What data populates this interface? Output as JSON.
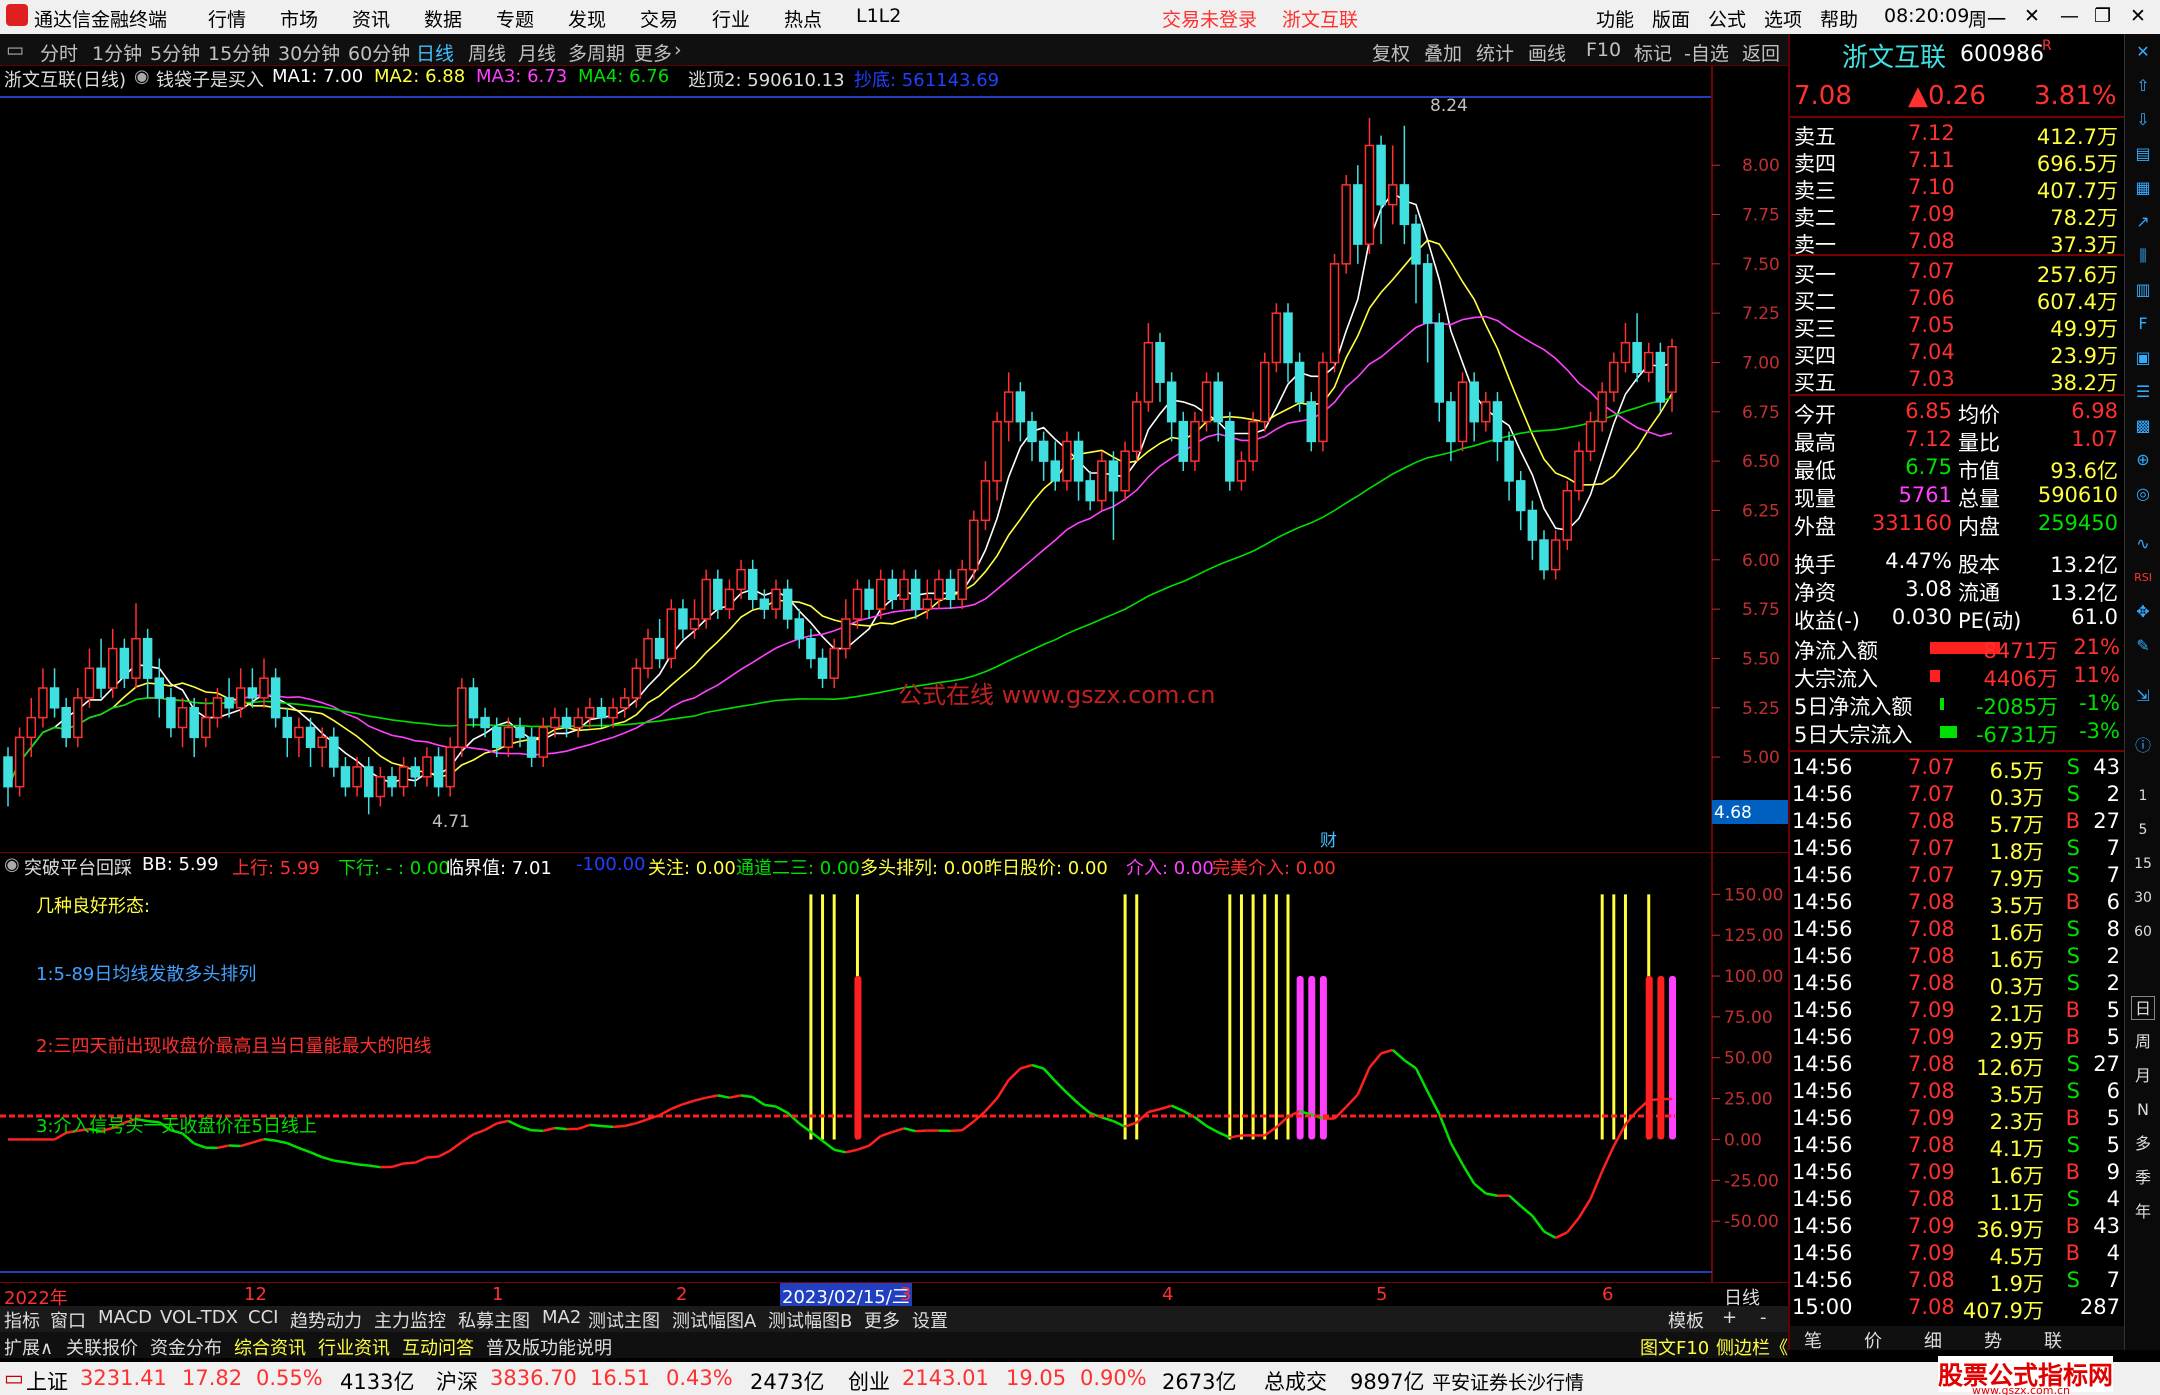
{
  "app": {
    "title": "通达信金融终端",
    "menu": [
      "行情",
      "市场",
      "资讯",
      "数据",
      "专题",
      "发现",
      "交易",
      "行业",
      "热点",
      "L1L2"
    ],
    "login": "交易未登录",
    "stock_title": "浙文互联",
    "right_menu": [
      "功能",
      "版面",
      "公式",
      "选项",
      "帮助"
    ],
    "time": "08:20:09",
    "weekday": "周一"
  },
  "periods": [
    "分时",
    "1分钟",
    "5分钟",
    "15分钟",
    "30分钟",
    "60分钟",
    "日线",
    "周线",
    "月线",
    "多周期",
    "更多"
  ],
  "chart_tools": [
    "复权",
    "叠加",
    "统计",
    "画线",
    "F10",
    "标记",
    "-自选",
    "返回"
  ],
  "main_legend": {
    "name": "浙文互联(日线)",
    "formula": "钱袋子是买入",
    "ma1": "MA1: 7.00",
    "ma2": "MA2: 6.88",
    "ma3": "MA3: 6.73",
    "ma4": "MA4: 6.76",
    "top": "逃顶2: 590610.13",
    "bottom": "抄底: 561143.69"
  },
  "watermark": "公式在线  www.gszx.com.cn",
  "high_label": "8.24",
  "low_label": "4.71",
  "price_axis": [
    "8.00",
    "7.75",
    "7.50",
    "7.25",
    "7.00",
    "6.75",
    "6.50",
    "6.25",
    "6.00",
    "5.75",
    "5.50",
    "5.25",
    "5.00"
  ],
  "cursor_price": "4.68",
  "cai": "财",
  "sub_legend": {
    "name": "突破平台回踩",
    "bb": "BB: 5.99",
    "up": "上行: 5.99",
    "down": "下行: - : 0.00",
    "crit": "临界值: 7.01",
    "m100": "-100.00",
    "focus": "关注: 0.00",
    "channel": "通道二三: 0.00",
    "bull": "多头排列: 0.00",
    "yday": "昨日股价: 0.00",
    "enter": "介入: 0.00",
    "perfect": "完美介入: 0.00"
  },
  "sub_notes": [
    "几种良好形态:",
    "1:5-89日均线发散多头排列",
    "2:三四天前出现收盘价最高且当日量能最大的阳线",
    "3:介入信号头一天收盘价在5日线上"
  ],
  "sub_axis": [
    "150.00",
    "125.00",
    "100.00",
    "75.00",
    "50.00",
    "25.00",
    "0.00",
    "-25.00",
    "-50.00"
  ],
  "date_axis": {
    "labels": [
      "2022年",
      "12",
      "1",
      "2",
      "2023/02/15/三",
      "3",
      "4",
      "5",
      "6"
    ],
    "cycle": "日线"
  },
  "bottom_tabs": [
    "指标",
    "窗口",
    "MACD",
    "VOL-TDX",
    "CCI",
    "趋势动力",
    "主力监控",
    "私募主图",
    "MA2",
    "测试主图",
    "测试幅图A",
    "测试幅图B",
    "更多",
    "设置"
  ],
  "bottom_right": [
    "模板",
    "+",
    "-"
  ],
  "toolbar2": [
    "扩展∧",
    "关联报价",
    "资金分布",
    "综合资讯",
    "行业资讯",
    "互动问答",
    "普及版功能说明"
  ],
  "quote": {
    "name": "浙文互联",
    "code": "600986",
    "price": "7.08",
    "change": "▲0.26",
    "pct": "3.81%",
    "asks": [
      [
        "卖五",
        "7.12",
        "412.7万"
      ],
      [
        "卖四",
        "7.11",
        "696.5万"
      ],
      [
        "卖三",
        "7.10",
        "407.7万"
      ],
      [
        "卖二",
        "7.09",
        "78.2万"
      ],
      [
        "卖一",
        "7.08",
        "37.3万"
      ]
    ],
    "bids": [
      [
        "买一",
        "7.07",
        "257.6万"
      ],
      [
        "买二",
        "7.06",
        "607.4万"
      ],
      [
        "买三",
        "7.05",
        "49.9万"
      ],
      [
        "买四",
        "7.04",
        "23.9万"
      ],
      [
        "买五",
        "7.03",
        "38.2万"
      ]
    ],
    "stats": [
      [
        "今开",
        "6.85",
        "均价",
        "6.98"
      ],
      [
        "最高",
        "7.12",
        "量比",
        "1.07"
      ],
      [
        "最低",
        "6.75",
        "市值",
        "93.6亿"
      ],
      [
        "现量",
        "5761",
        "总量",
        "590610"
      ],
      [
        "外盘",
        "331160",
        "内盘",
        "259450"
      ],
      [
        "换手",
        "4.47%",
        "股本",
        "13.2亿"
      ],
      [
        "净资",
        "3.08",
        "流通",
        "13.2亿"
      ],
      [
        "收益(-)",
        "0.030",
        "PE(动)",
        "61.0"
      ]
    ],
    "flows": [
      [
        "净流入额",
        "8471万",
        "21%"
      ],
      [
        "大宗流入",
        "4406万",
        "11%"
      ],
      [
        "5日净流入额",
        "-2085万",
        "-1%"
      ],
      [
        "5日大宗流入",
        "-6731万",
        "-3%"
      ]
    ],
    "ticks": [
      [
        "14:56",
        "7.07",
        "6.5万",
        "S",
        "43"
      ],
      [
        "14:56",
        "7.07",
        "0.3万",
        "S",
        "2"
      ],
      [
        "14:56",
        "7.08",
        "5.7万",
        "B",
        "27"
      ],
      [
        "14:56",
        "7.07",
        "1.8万",
        "S",
        "7"
      ],
      [
        "14:56",
        "7.07",
        "7.9万",
        "S",
        "7"
      ],
      [
        "14:56",
        "7.08",
        "3.5万",
        "B",
        "6"
      ],
      [
        "14:56",
        "7.08",
        "1.6万",
        "S",
        "8"
      ],
      [
        "14:56",
        "7.08",
        "1.6万",
        "S",
        "2"
      ],
      [
        "14:56",
        "7.08",
        "0.3万",
        "S",
        "2"
      ],
      [
        "14:56",
        "7.09",
        "2.1万",
        "B",
        "5"
      ],
      [
        "14:56",
        "7.09",
        "2.9万",
        "B",
        "5"
      ],
      [
        "14:56",
        "7.08",
        "12.6万",
        "S",
        "27"
      ],
      [
        "14:56",
        "7.08",
        "3.5万",
        "S",
        "6"
      ],
      [
        "14:56",
        "7.09",
        "2.3万",
        "B",
        "5"
      ],
      [
        "14:56",
        "7.08",
        "4.1万",
        "S",
        "5"
      ],
      [
        "14:56",
        "7.09",
        "1.6万",
        "B",
        "9"
      ],
      [
        "14:56",
        "7.08",
        "1.1万",
        "S",
        "4"
      ],
      [
        "14:56",
        "7.09",
        "36.9万",
        "B",
        "43"
      ],
      [
        "14:56",
        "7.09",
        "4.5万",
        "B",
        "4"
      ],
      [
        "14:56",
        "7.08",
        "1.9万",
        "S",
        "7"
      ],
      [
        "15:00",
        "7.08",
        "407.9万",
        "",
        "287"
      ]
    ]
  },
  "sidebar": [
    "日",
    "周",
    "月",
    "N",
    "多",
    "季",
    "年",
    "1",
    "5",
    "15",
    "30",
    "60",
    "RSI"
  ],
  "panel_tabs": [
    "图文F10",
    "侧边栏《",
    "笔",
    "价",
    "细",
    "势",
    "联"
  ],
  "status": {
    "sh_name": "上证",
    "sh": "3231.41",
    "sh_chg": "17.82",
    "sh_pct": "0.55%",
    "sh_amt": "4133亿",
    "sz_name": "沪深",
    "sz": "3836.70",
    "sz_chg": "16.51",
    "sz_pct": "0.43%",
    "sz_amt": "2473亿",
    "cy_name": "创业",
    "cy": "2143.01",
    "cy_chg": "19.05",
    "cy_pct": "0.90%",
    "cy_amt": "2673亿",
    "total_name": "总成交",
    "total": "9897亿",
    "broker": "平安证券长沙行情",
    "logo": "股票公式指标网",
    "logo_url": "www.gszx.com.cn"
  },
  "chart_data": {
    "type": "candlestick",
    "price_ylim": [
      4.6,
      8.3
    ],
    "sub_ylim": [
      -75,
      160
    ],
    "candles": [
      [
        5.0,
        4.85,
        5.05,
        4.75
      ],
      [
        4.85,
        5.1,
        5.15,
        4.8
      ],
      [
        5.1,
        5.2,
        5.3,
        5.0
      ],
      [
        5.2,
        5.35,
        5.45,
        5.15
      ],
      [
        5.35,
        5.25,
        5.45,
        5.2
      ],
      [
        5.25,
        5.1,
        5.3,
        5.05
      ],
      [
        5.1,
        5.3,
        5.35,
        5.05
      ],
      [
        5.3,
        5.45,
        5.55,
        5.25
      ],
      [
        5.45,
        5.35,
        5.6,
        5.3
      ],
      [
        5.35,
        5.55,
        5.65,
        5.3
      ],
      [
        5.55,
        5.4,
        5.6,
        5.35
      ],
      [
        5.4,
        5.6,
        5.78,
        5.35
      ],
      [
        5.6,
        5.4,
        5.65,
        5.3
      ],
      [
        5.4,
        5.3,
        5.5,
        5.2
      ],
      [
        5.3,
        5.15,
        5.35,
        5.1
      ],
      [
        5.15,
        5.25,
        5.3,
        5.05
      ],
      [
        5.25,
        5.1,
        5.3,
        5.0
      ],
      [
        5.1,
        5.2,
        5.3,
        5.05
      ],
      [
        5.2,
        5.3,
        5.35,
        5.15
      ],
      [
        5.3,
        5.25,
        5.4,
        5.2
      ],
      [
        5.25,
        5.35,
        5.45,
        5.2
      ],
      [
        5.35,
        5.3,
        5.45,
        5.25
      ],
      [
        5.3,
        5.4,
        5.5,
        5.25
      ],
      [
        5.4,
        5.2,
        5.45,
        5.15
      ],
      [
        5.2,
        5.1,
        5.25,
        5.0
      ],
      [
        5.1,
        5.15,
        5.2,
        5.0
      ],
      [
        5.15,
        5.05,
        5.2,
        4.95
      ],
      [
        5.05,
        5.1,
        5.15,
        4.95
      ],
      [
        5.1,
        4.95,
        5.15,
        4.9
      ],
      [
        4.95,
        4.85,
        5.0,
        4.8
      ],
      [
        4.85,
        4.95,
        5.0,
        4.8
      ],
      [
        4.95,
        4.8,
        5.0,
        4.71
      ],
      [
        4.8,
        4.9,
        4.95,
        4.75
      ],
      [
        4.9,
        4.85,
        4.95,
        4.8
      ],
      [
        4.85,
        4.95,
        5.0,
        4.8
      ],
      [
        4.95,
        4.9,
        5.0,
        4.85
      ],
      [
        4.9,
        5.0,
        5.05,
        4.85
      ],
      [
        5.0,
        4.85,
        5.05,
        4.8
      ],
      [
        4.85,
        5.05,
        5.1,
        4.8
      ],
      [
        5.05,
        5.35,
        5.4,
        5.0
      ],
      [
        5.35,
        5.2,
        5.4,
        5.15
      ],
      [
        5.2,
        5.15,
        5.25,
        5.1
      ],
      [
        5.15,
        5.05,
        5.2,
        5.0
      ],
      [
        5.05,
        5.15,
        5.2,
        5.0
      ],
      [
        5.15,
        5.1,
        5.2,
        5.05
      ],
      [
        5.1,
        5.0,
        5.15,
        4.95
      ],
      [
        5.0,
        5.15,
        5.2,
        4.95
      ],
      [
        5.15,
        5.2,
        5.25,
        5.1
      ],
      [
        5.2,
        5.15,
        5.25,
        5.1
      ],
      [
        5.15,
        5.2,
        5.25,
        5.1
      ],
      [
        5.2,
        5.25,
        5.3,
        5.15
      ],
      [
        5.25,
        5.2,
        5.3,
        5.15
      ],
      [
        5.2,
        5.25,
        5.3,
        5.15
      ],
      [
        5.25,
        5.3,
        5.35,
        5.2
      ],
      [
        5.3,
        5.45,
        5.5,
        5.25
      ],
      [
        5.45,
        5.6,
        5.65,
        5.4
      ],
      [
        5.6,
        5.5,
        5.7,
        5.45
      ],
      [
        5.5,
        5.75,
        5.8,
        5.45
      ],
      [
        5.75,
        5.65,
        5.8,
        5.6
      ],
      [
        5.65,
        5.7,
        5.8,
        5.6
      ],
      [
        5.7,
        5.9,
        5.95,
        5.65
      ],
      [
        5.9,
        5.75,
        5.95,
        5.7
      ],
      [
        5.75,
        5.85,
        5.9,
        5.7
      ],
      [
        5.85,
        5.95,
        6.0,
        5.8
      ],
      [
        5.95,
        5.8,
        6.0,
        5.75
      ],
      [
        5.8,
        5.75,
        5.85,
        5.7
      ],
      [
        5.75,
        5.85,
        5.9,
        5.7
      ],
      [
        5.85,
        5.7,
        5.9,
        5.65
      ],
      [
        5.7,
        5.6,
        5.75,
        5.55
      ],
      [
        5.6,
        5.5,
        5.65,
        5.45
      ],
      [
        5.5,
        5.4,
        5.55,
        5.35
      ],
      [
        5.4,
        5.55,
        5.6,
        5.35
      ],
      [
        5.55,
        5.7,
        5.8,
        5.5
      ],
      [
        5.7,
        5.85,
        5.9,
        5.65
      ],
      [
        5.85,
        5.75,
        5.9,
        5.7
      ],
      [
        5.75,
        5.9,
        5.95,
        5.7
      ],
      [
        5.9,
        5.8,
        5.95,
        5.75
      ],
      [
        5.8,
        5.9,
        5.95,
        5.75
      ],
      [
        5.9,
        5.75,
        5.95,
        5.7
      ],
      [
        5.75,
        5.8,
        5.9,
        5.7
      ],
      [
        5.8,
        5.9,
        5.95,
        5.75
      ],
      [
        5.9,
        5.8,
        5.95,
        5.75
      ],
      [
        5.8,
        5.95,
        6.0,
        5.75
      ],
      [
        5.95,
        6.2,
        6.25,
        5.9
      ],
      [
        6.2,
        6.4,
        6.5,
        6.15
      ],
      [
        6.4,
        6.7,
        6.75,
        6.3
      ],
      [
        6.7,
        6.85,
        6.95,
        6.6
      ],
      [
        6.85,
        6.7,
        6.9,
        6.6
      ],
      [
        6.7,
        6.6,
        6.75,
        6.5
      ],
      [
        6.6,
        6.5,
        6.65,
        6.4
      ],
      [
        6.5,
        6.4,
        6.6,
        6.35
      ],
      [
        6.4,
        6.6,
        6.65,
        6.35
      ],
      [
        6.6,
        6.4,
        6.65,
        6.3
      ],
      [
        6.4,
        6.3,
        6.45,
        6.25
      ],
      [
        6.3,
        6.5,
        6.55,
        6.25
      ],
      [
        6.5,
        6.35,
        6.55,
        6.1
      ],
      [
        6.35,
        6.55,
        6.6,
        6.3
      ],
      [
        6.55,
        6.8,
        6.85,
        6.5
      ],
      [
        6.8,
        7.1,
        7.2,
        6.75
      ],
      [
        7.1,
        6.9,
        7.15,
        6.8
      ],
      [
        6.9,
        6.7,
        6.95,
        6.6
      ],
      [
        6.7,
        6.5,
        6.75,
        6.45
      ],
      [
        6.5,
        6.7,
        6.75,
        6.45
      ],
      [
        6.7,
        6.9,
        6.95,
        6.65
      ],
      [
        6.9,
        6.7,
        6.95,
        6.6
      ],
      [
        6.7,
        6.4,
        6.75,
        6.35
      ],
      [
        6.4,
        6.5,
        6.55,
        6.35
      ],
      [
        6.5,
        6.7,
        6.75,
        6.45
      ],
      [
        6.7,
        7.0,
        7.05,
        6.65
      ],
      [
        7.0,
        7.25,
        7.3,
        6.95
      ],
      [
        7.25,
        7.0,
        7.3,
        6.9
      ],
      [
        7.0,
        6.8,
        7.05,
        6.75
      ],
      [
        6.8,
        6.6,
        6.85,
        6.55
      ],
      [
        6.6,
        7.0,
        7.05,
        6.55
      ],
      [
        7.0,
        7.5,
        7.55,
        6.95
      ],
      [
        7.5,
        7.9,
        7.95,
        7.45
      ],
      [
        7.9,
        7.6,
        8.0,
        7.5
      ],
      [
        7.6,
        8.1,
        8.24,
        7.55
      ],
      [
        8.1,
        7.8,
        8.15,
        7.6
      ],
      [
        7.8,
        7.9,
        8.1,
        7.7
      ],
      [
        7.9,
        7.7,
        8.2,
        7.6
      ],
      [
        7.7,
        7.5,
        7.75,
        7.3
      ],
      [
        7.5,
        7.2,
        7.55,
        7.0
      ],
      [
        7.2,
        6.8,
        7.25,
        6.7
      ],
      [
        6.8,
        6.6,
        6.85,
        6.5
      ],
      [
        6.6,
        6.9,
        6.95,
        6.55
      ],
      [
        6.9,
        6.7,
        6.95,
        6.6
      ],
      [
        6.7,
        6.8,
        6.85,
        6.65
      ],
      [
        6.8,
        6.6,
        6.85,
        6.5
      ],
      [
        6.6,
        6.4,
        6.65,
        6.3
      ],
      [
        6.4,
        6.25,
        6.45,
        6.15
      ],
      [
        6.25,
        6.1,
        6.3,
        6.0
      ],
      [
        6.1,
        5.95,
        6.15,
        5.9
      ],
      [
        5.95,
        6.1,
        6.15,
        5.9
      ],
      [
        6.1,
        6.35,
        6.4,
        6.05
      ],
      [
        6.35,
        6.55,
        6.6,
        6.3
      ],
      [
        6.55,
        6.7,
        6.75,
        6.5
      ],
      [
        6.7,
        6.85,
        6.9,
        6.65
      ],
      [
        6.85,
        7.0,
        7.05,
        6.8
      ],
      [
        7.0,
        7.1,
        7.2,
        6.95
      ],
      [
        7.1,
        6.95,
        7.25,
        6.9
      ],
      [
        6.95,
        7.05,
        7.1,
        6.9
      ],
      [
        7.05,
        6.8,
        7.1,
        6.75
      ],
      [
        6.85,
        7.08,
        7.12,
        6.75
      ]
    ]
  }
}
